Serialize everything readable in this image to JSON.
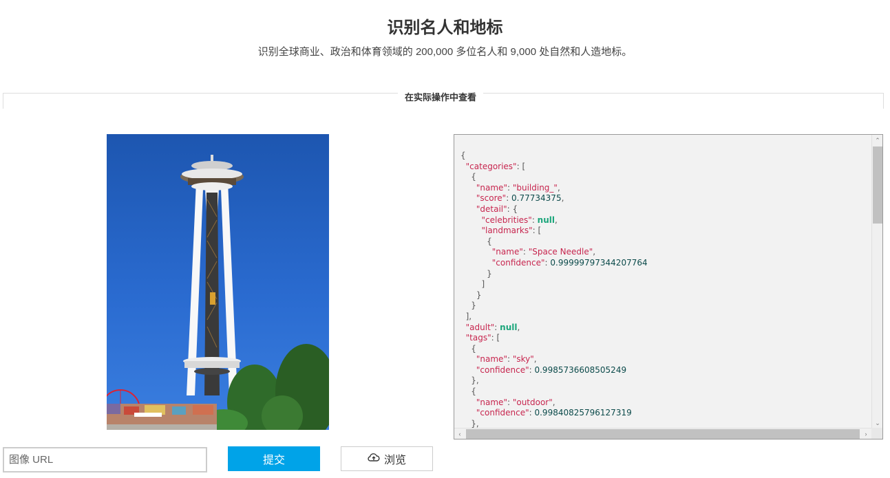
{
  "header": {
    "title": "识别名人和地标",
    "subtitle": "识别全球商业、政治和体育领域的 200,000 多位名人和 9,000 处自然和人造地标。"
  },
  "section": {
    "heading": "在实际操作中查看"
  },
  "result_json_lines": [
    [
      [
        "p",
        "{"
      ]
    ],
    [
      [
        "p",
        "  "
      ],
      [
        "k",
        "\"categories\""
      ],
      [
        "p",
        ": ["
      ]
    ],
    [
      [
        "p",
        "    {"
      ]
    ],
    [
      [
        "p",
        "      "
      ],
      [
        "k",
        "\"name\""
      ],
      [
        "p",
        ": "
      ],
      [
        "s",
        "\"building_\""
      ],
      [
        "p",
        ","
      ]
    ],
    [
      [
        "p",
        "      "
      ],
      [
        "k",
        "\"score\""
      ],
      [
        "p",
        ": "
      ],
      [
        "n",
        "0.77734375"
      ],
      [
        "p",
        ","
      ]
    ],
    [
      [
        "p",
        "      "
      ],
      [
        "k",
        "\"detail\""
      ],
      [
        "p",
        ": {"
      ]
    ],
    [
      [
        "p",
        "        "
      ],
      [
        "k",
        "\"celebrities\""
      ],
      [
        "p",
        ": "
      ],
      [
        "null",
        "null"
      ],
      [
        "p",
        ","
      ]
    ],
    [
      [
        "p",
        "        "
      ],
      [
        "k",
        "\"landmarks\""
      ],
      [
        "p",
        ": ["
      ]
    ],
    [
      [
        "p",
        "          {"
      ]
    ],
    [
      [
        "p",
        "            "
      ],
      [
        "k",
        "\"name\""
      ],
      [
        "p",
        ": "
      ],
      [
        "s",
        "\"Space Needle\""
      ],
      [
        "p",
        ","
      ]
    ],
    [
      [
        "p",
        "            "
      ],
      [
        "k",
        "\"confidence\""
      ],
      [
        "p",
        ": "
      ],
      [
        "n",
        "0.99999797344207764"
      ]
    ],
    [
      [
        "p",
        "          }"
      ]
    ],
    [
      [
        "p",
        "        ]"
      ]
    ],
    [
      [
        "p",
        "      }"
      ]
    ],
    [
      [
        "p",
        "    }"
      ]
    ],
    [
      [
        "p",
        "  ],"
      ]
    ],
    [
      [
        "p",
        "  "
      ],
      [
        "k",
        "\"adult\""
      ],
      [
        "p",
        ": "
      ],
      [
        "null",
        "null"
      ],
      [
        "p",
        ","
      ]
    ],
    [
      [
        "p",
        "  "
      ],
      [
        "k",
        "\"tags\""
      ],
      [
        "p",
        ": ["
      ]
    ],
    [
      [
        "p",
        "    {"
      ]
    ],
    [
      [
        "p",
        "      "
      ],
      [
        "k",
        "\"name\""
      ],
      [
        "p",
        ": "
      ],
      [
        "s",
        "\"sky\""
      ],
      [
        "p",
        ","
      ]
    ],
    [
      [
        "p",
        "      "
      ],
      [
        "k",
        "\"confidence\""
      ],
      [
        "p",
        ": "
      ],
      [
        "n",
        "0.9985736608505249"
      ]
    ],
    [
      [
        "p",
        "    },"
      ]
    ],
    [
      [
        "p",
        "    {"
      ]
    ],
    [
      [
        "p",
        "      "
      ],
      [
        "k",
        "\"name\""
      ],
      [
        "p",
        ": "
      ],
      [
        "s",
        "\"outdoor\""
      ],
      [
        "p",
        ","
      ]
    ],
    [
      [
        "p",
        "      "
      ],
      [
        "k",
        "\"confidence\""
      ],
      [
        "p",
        ": "
      ],
      [
        "n",
        "0.99840825796127319"
      ]
    ],
    [
      [
        "p",
        "    },"
      ]
    ]
  ],
  "controls": {
    "url_placeholder": "图像 URL",
    "url_value": "",
    "submit_label": "提交",
    "browse_label": "浏览",
    "browse_icon": "cloud-upload-icon"
  },
  "colors": {
    "submit_bg": "#00a3e8",
    "json_key": "#c7254e",
    "json_number": "#0b4a4a",
    "json_null": "#1aa57a"
  }
}
